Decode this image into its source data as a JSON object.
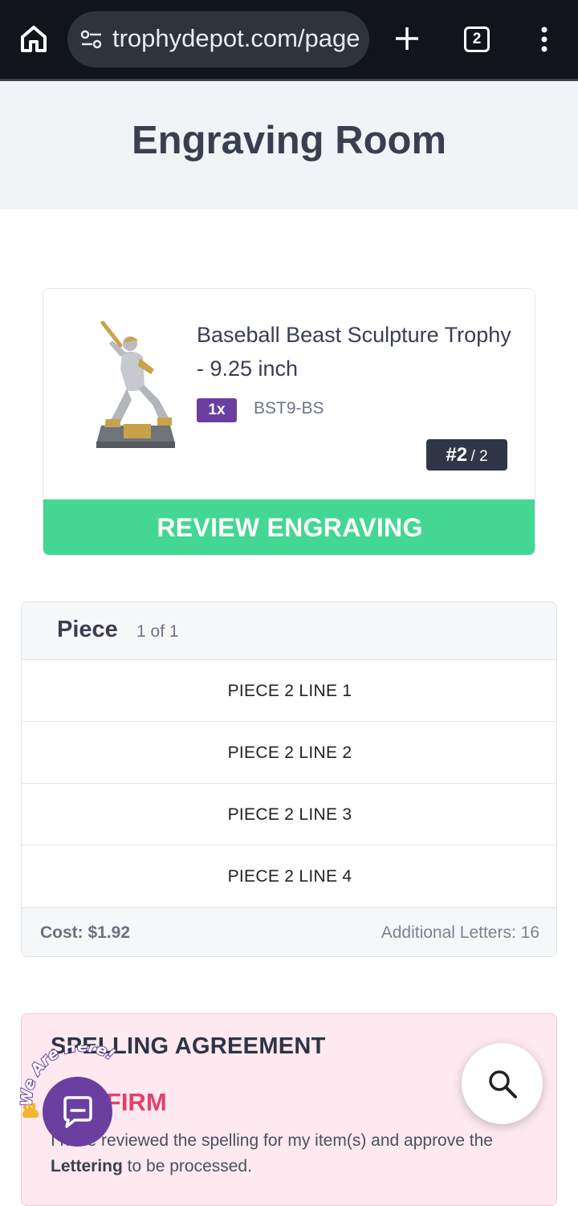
{
  "browser": {
    "url": "trophydepot.com/page",
    "tab_count": "2",
    "icons": [
      "home-icon",
      "site-settings-icon",
      "new-tab-icon",
      "tab-switcher-icon",
      "overflow-menu-icon"
    ]
  },
  "page": {
    "title": "Engraving Room"
  },
  "product": {
    "name": "Baseball Beast Sculpture Trophy - 9.25 inch",
    "quantity": "1x",
    "sku": "BST9-BS",
    "index_current": "#2",
    "index_total": "/ 2",
    "review_button": "REVIEW ENGRAVING"
  },
  "piece": {
    "title": "Piece",
    "count": "1 of 1",
    "lines": [
      "PIECE 2 LINE 1",
      "PIECE 2 LINE 2",
      "PIECE 2 LINE 3",
      "PIECE 2 LINE 4"
    ],
    "cost": "Cost: $1.92",
    "additional_letters": "Additional Letters: 16"
  },
  "spelling": {
    "title": "SPELLING AGREEMENT",
    "confirm": "CONFIRM",
    "text_before": "I have reviewed the spelling for my item(s) and approve the ",
    "text_bold": "Lettering",
    "text_after": " to be processed."
  },
  "chat_widget": {
    "tagline": "We Are Here!"
  },
  "colors": {
    "accent_green": "#44d693",
    "badge_purple": "#6a3fa0",
    "confirm_pink": "#e5406a",
    "dark_badge": "#2f3647"
  }
}
